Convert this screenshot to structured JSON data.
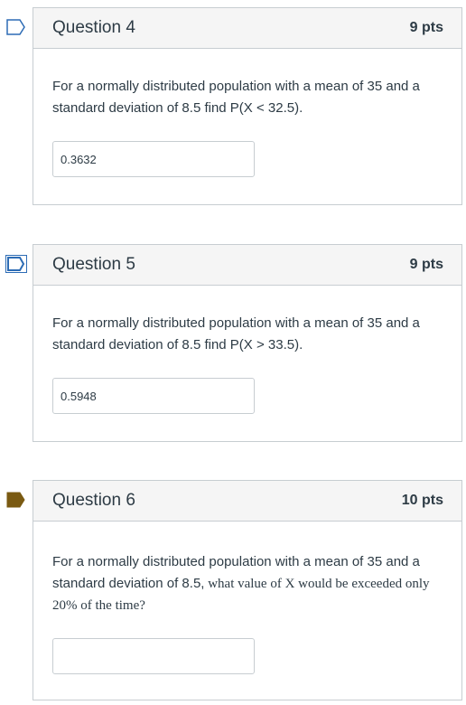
{
  "questions": [
    {
      "title": "Question 4",
      "points": "9 pts",
      "text": "For a normally distributed population with a mean of 35 and a standard deviation of 8.5 find P(X < 32.5).",
      "answer": "0.3632",
      "flag": "outline"
    },
    {
      "title": "Question 5",
      "points": "9 pts",
      "text": "For a normally distributed population with a mean of 35 and a standard deviation of 8.5 find P(X > 33.5).",
      "answer": "0.5948",
      "flag": "outline-focused"
    },
    {
      "title": "Question 6",
      "points": "10 pts",
      "text_sans": "For a normally distributed population with a mean of 35 and a standard deviation of 8.5,",
      "text_serif": " what value of X would be exceeded only 20% of the time?",
      "answer": "",
      "flag": "filled"
    }
  ],
  "colors": {
    "flag_outline": "#2d6cb5",
    "flag_filled": "#7a5a12",
    "border": "#c7cdd1",
    "header_bg": "#f5f5f5",
    "text": "#2d3b45"
  }
}
